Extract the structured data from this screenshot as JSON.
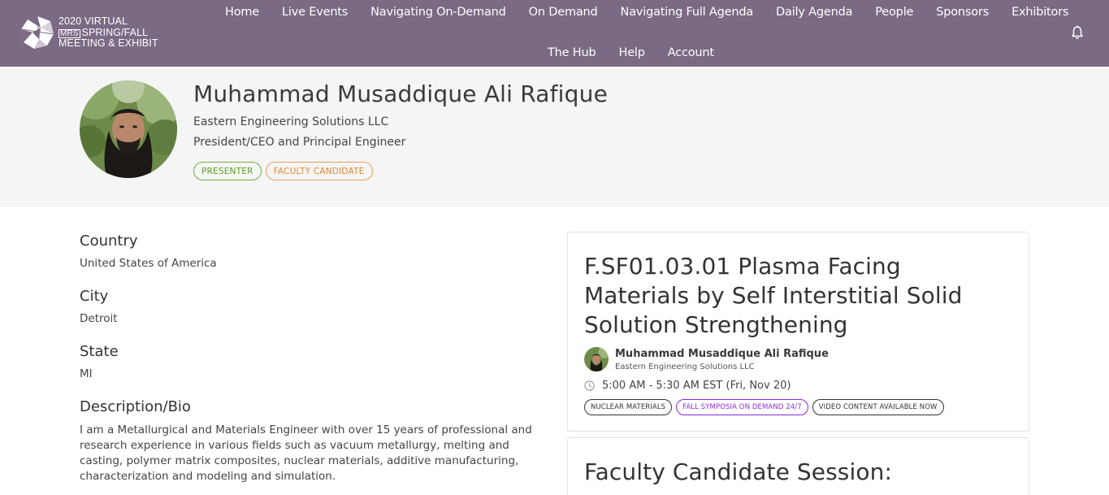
{
  "header": {
    "logo": {
      "line1": "2020 VIRTUAL",
      "mrs": "MRS",
      "line2": "SPRING/FALL",
      "line3": "MEETING & EXHIBIT"
    },
    "nav_row1": [
      "Home",
      "Live Events",
      "Navigating On-Demand",
      "On Demand",
      "Navigating Full Agenda",
      "Daily Agenda",
      "People",
      "Sponsors",
      "Exhibitors"
    ],
    "nav_row2": [
      "The Hub",
      "Help",
      "Account"
    ],
    "notification_icon": "bell-icon"
  },
  "profile": {
    "name": "Muhammad Musaddique Ali Rafique",
    "company": "Eastern Engineering Solutions LLC",
    "role": "President/CEO and Principal Engineer",
    "badges": [
      "PRESENTER",
      "FACULTY CANDIDATE"
    ],
    "badge_colors": {
      "presenter": "#5aa11f",
      "faculty": "#e08a34"
    }
  },
  "details": {
    "country_label": "Country",
    "country": "United States of America",
    "city_label": "City",
    "city": "Detroit",
    "state_label": "State",
    "state": "MI",
    "bio_label": "Description/Bio",
    "bio": "I am a Metallurgical and Materials Engineer with over 15 years of professional and research experience in various fields such as vacuum metallurgy, melting and casting, polymer matrix composites, nuclear materials, additive manufacturing, characterization and modeling and simulation."
  },
  "sessions": [
    {
      "title": "F.SF01.03.01 Plasma Facing Materials by Self Interstitial Solid Solution Strengthening",
      "presenter_name": "Muhammad Musaddique Ali Rafique",
      "presenter_company": "Eastern Engineering Solutions LLC",
      "time": "5:00 AM - 5:30 AM EST (Fri, Nov 20)",
      "tags": [
        "NUCLEAR MATERIALS",
        "FALL SYMPOSIA ON DEMAND 24/7",
        "VIDEO CONTENT AVAILABLE NOW"
      ]
    },
    {
      "title": "Faculty Candidate Session:"
    }
  ],
  "colors": {
    "header_bg": "#7a6a83",
    "band_bg": "#f5f5f5",
    "tag_purple": "#8a2be2"
  }
}
